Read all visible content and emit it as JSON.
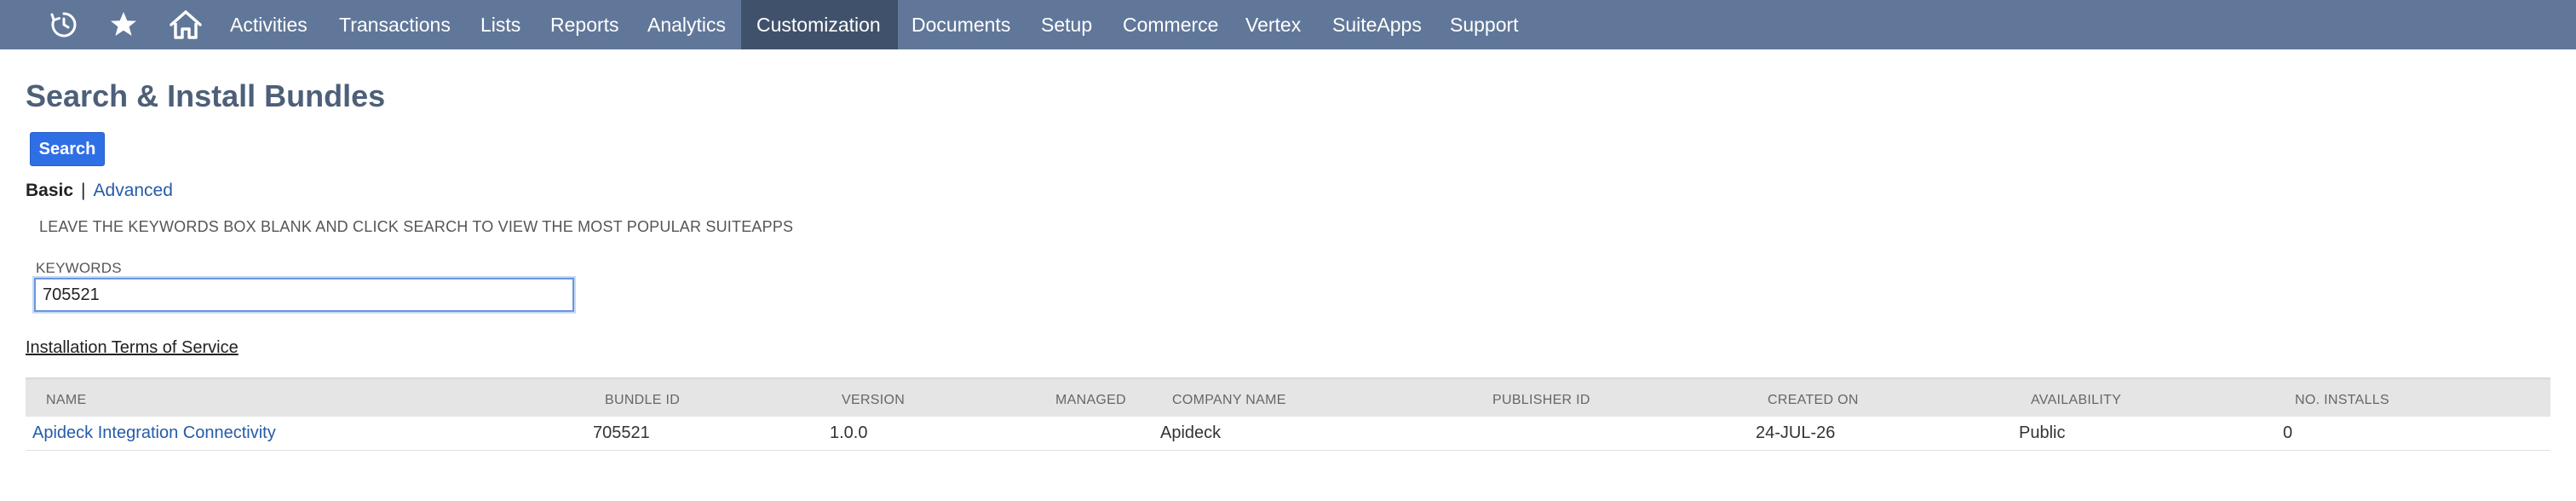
{
  "nav": {
    "icons": [
      "recent-records-icon",
      "star-icon",
      "home-icon"
    ],
    "items": [
      {
        "label": "Activities"
      },
      {
        "label": "Transactions"
      },
      {
        "label": "Lists"
      },
      {
        "label": "Reports"
      },
      {
        "label": "Analytics"
      },
      {
        "label": "Customization",
        "active": true
      },
      {
        "label": "Documents"
      },
      {
        "label": "Setup"
      },
      {
        "label": "Commerce"
      },
      {
        "label": "Vertex"
      },
      {
        "label": "SuiteApps"
      },
      {
        "label": "Support"
      }
    ]
  },
  "page": {
    "title": "Search & Install Bundles",
    "search_button": "Search",
    "mode_basic": "Basic",
    "mode_separator": "|",
    "mode_advanced": "Advanced",
    "hint": "LEAVE THE KEYWORDS BOX BLANK AND CLICK SEARCH TO VIEW THE MOST POPULAR SUITEAPPS",
    "keywords_label": "KEYWORDS",
    "keywords_value": "705521",
    "tos_link": "Installation Terms of Service"
  },
  "results": {
    "columns": [
      "NAME",
      "BUNDLE ID",
      "VERSION",
      "MANAGED",
      "COMPANY NAME",
      "PUBLISHER ID",
      "CREATED ON",
      "AVAILABILITY",
      "NO. INSTALLS"
    ],
    "rows": [
      {
        "name": "Apideck Integration Connectivity",
        "bundle_id": "705521",
        "version": "1.0.0",
        "managed": "",
        "company_name": "Apideck",
        "publisher_id": "",
        "created_on": "24-JUL-26",
        "availability": "Public",
        "installs": "0"
      }
    ]
  },
  "colors": {
    "nav_bg": "#607799",
    "nav_active": "#40516b",
    "title": "#4d5f79",
    "button": "#2f6fe6",
    "link": "#255ba8",
    "table_header": "#e5e5e5"
  }
}
